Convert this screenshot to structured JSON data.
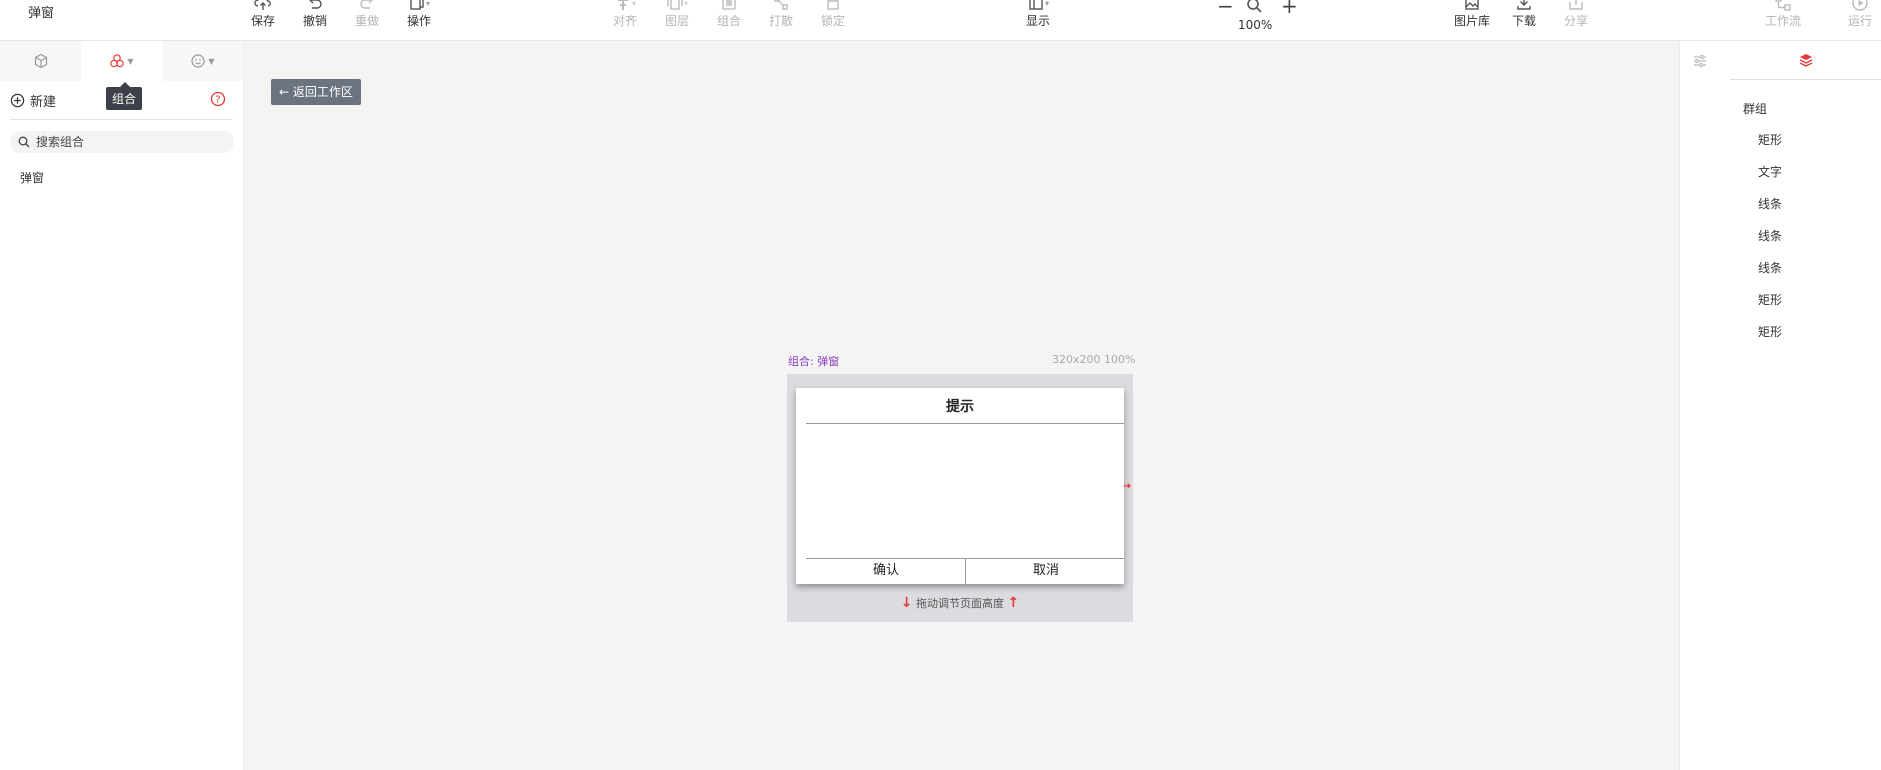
{
  "header": {
    "title": "弹窗",
    "tools": {
      "save": "保存",
      "undo": "撤销",
      "redo": "重做",
      "operate": "操作",
      "align": "对齐",
      "layer": "图层",
      "group": "组合",
      "ungroup": "打散",
      "lock": "锁定",
      "display": "显示",
      "gallery": "图片库",
      "download": "下载",
      "share": "分享",
      "workflow": "工作流",
      "run": "运行"
    },
    "zoom": {
      "minus": "−",
      "plus": "+",
      "value": "100%"
    }
  },
  "left_panel": {
    "tooltip": "组合",
    "new_label": "新建",
    "search_placeholder": "搜索组合",
    "items": [
      "弹窗"
    ]
  },
  "canvas": {
    "back_button": "← 返回工作区",
    "artboard_label": "组合: 弹窗",
    "artboard_size": "320x200 100%",
    "dialog": {
      "title": "提示",
      "confirm": "确认",
      "cancel": "取消"
    },
    "drag_hint": "拖动调节页面高度"
  },
  "layers": {
    "root": "群组",
    "items": [
      "矩形",
      "文字",
      "线条",
      "线条",
      "线条",
      "矩形",
      "矩形"
    ]
  },
  "colors": {
    "accent": "#e53935",
    "artboard_label": "#8a3ab9",
    "back_button": "#6b7280"
  }
}
